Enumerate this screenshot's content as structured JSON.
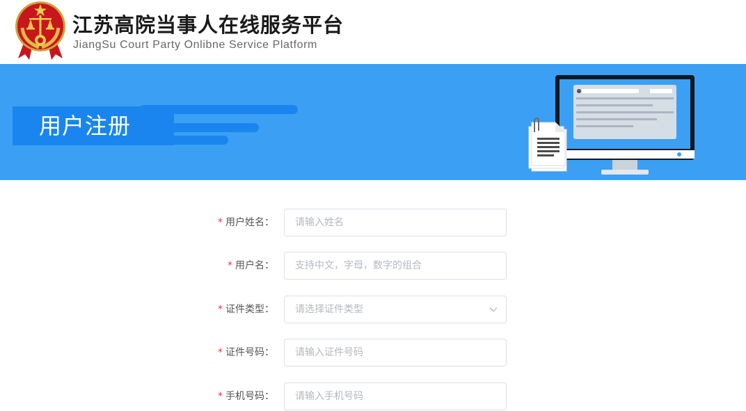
{
  "header": {
    "title": "江苏高院当事人在线服务平台",
    "subtitle": "JiangSu Court Party Onlibne Service Platform",
    "emblem_icon": "court-emblem-icon"
  },
  "banner": {
    "title": "用户注册",
    "illustration_icon": "computer-document-illustration-icon"
  },
  "colors": {
    "banner_bg": "#3ba0f3",
    "banner_tab": "#1a85ee",
    "required_mark": "#e63a3a",
    "input_border": "#dcdfe6"
  },
  "form": {
    "required_mark": "*",
    "fields": [
      {
        "label": "用户姓名：",
        "placeholder": "请输入姓名",
        "type": "text"
      },
      {
        "label": "用户名：",
        "placeholder": "支持中文，字母，数字的组合",
        "type": "text"
      },
      {
        "label": "证件类型：",
        "placeholder": "请选择证件类型",
        "type": "select",
        "icon": "chevron-down-icon"
      },
      {
        "label": "证件号码：",
        "placeholder": "请输入证件号码",
        "type": "text"
      },
      {
        "label": "手机号码：",
        "placeholder": "请输入手机号码",
        "type": "text"
      }
    ]
  }
}
